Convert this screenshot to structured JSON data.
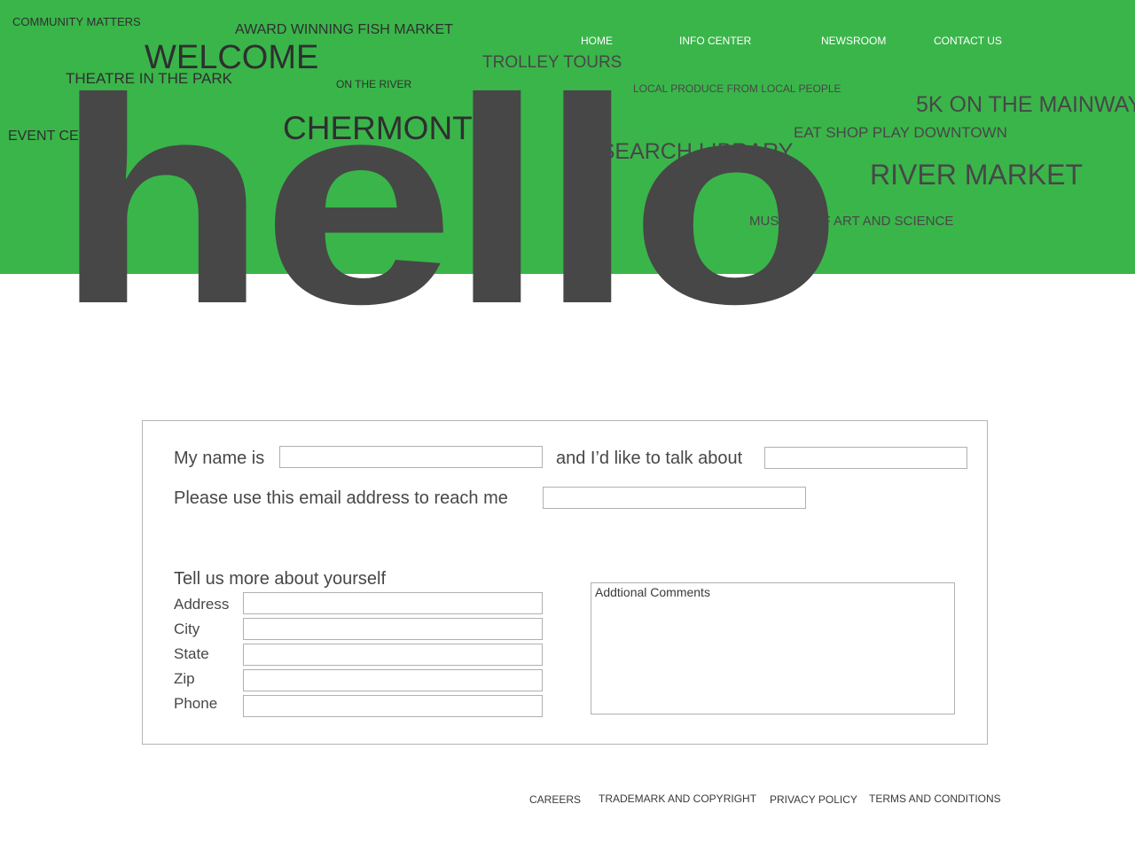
{
  "hero": {
    "background_color": "#3ab54a",
    "big_word": "hello",
    "words": [
      "COMMUNITY MATTERS",
      "AWARD WINNING FISH MARKET",
      "WELCOME",
      "THEATRE IN THE PARK",
      "ON THE RIVER",
      "TROLLEY TOURS",
      "LOCAL PRODUCE FROM LOCAL PEOPLE",
      "5K ON THE MAINWAY",
      "EVENT CENTER",
      "CHERMONT",
      "EAT SHOP PLAY DOWNTOWN",
      "RESEARCH LIBRARY",
      "RIVER MARKET",
      "MUSEUM OF ART AND SCIENCE"
    ]
  },
  "nav": {
    "items": [
      "HOME",
      "INFO CENTER",
      "NEWSROOM",
      "CONTACT US"
    ]
  },
  "form": {
    "name_prefix": "My name is",
    "talk_about": "and I’d like to talk about",
    "email_prompt": "Please use this email address to reach me",
    "more_heading": "Tell us more about yourself",
    "fields": [
      "Address",
      "City",
      "State",
      "Zip",
      "Phone"
    ],
    "comments_placeholder": "Addtional Comments",
    "name_value": "",
    "topic_value": "",
    "email_value": ""
  },
  "footer": {
    "links": [
      "CAREERS",
      "TRADEMARK AND COPYRIGHT",
      "PRIVACY POLICY",
      "TERMS AND CONDITIONS"
    ]
  }
}
